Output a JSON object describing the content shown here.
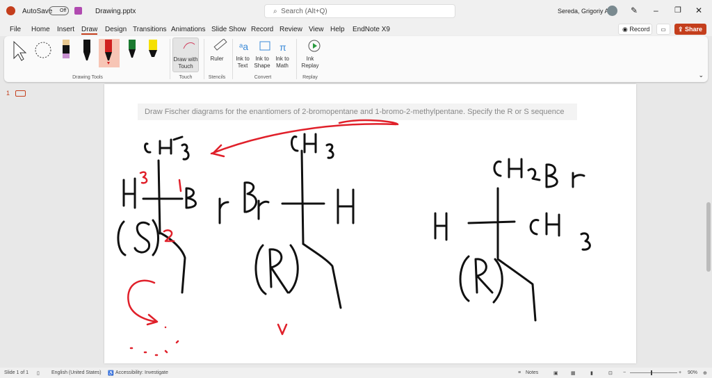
{
  "titlebar": {
    "autosave": "AutoSave",
    "autosave_state": "Off",
    "filename": "Drawing.pptx",
    "search_placeholder": "Search (Alt+Q)",
    "user": "Sereda, Grigoriy A"
  },
  "menu": [
    "File",
    "Home",
    "Insert",
    "Draw",
    "Design",
    "Transitions",
    "Animations",
    "Slide Show",
    "Record",
    "Review",
    "View",
    "Help",
    "EndNote X9"
  ],
  "actions": {
    "record": "Record",
    "share": "Share"
  },
  "ribbon": {
    "draw_with_touch": "Draw with Touch",
    "ruler": "Ruler",
    "ink_to_text": "Ink to Text",
    "ink_to_shape": "Ink to Shape",
    "ink_to_math": "Ink to Math",
    "ink_replay": "Ink Replay",
    "groups": [
      "Drawing Tools",
      "Touch",
      "Stencils",
      "Convert",
      "Replay"
    ]
  },
  "thumbnail": {
    "number": "1"
  },
  "slide": {
    "question": "Draw Fischer diagrams for the enantiomers of 2-bromopentane and 1-bromo-2-methylpentane. Specify the R or S sequence"
  },
  "status": {
    "slide": "Slide 1 of 1",
    "language": "English (United States)",
    "accessibility": "Accessibility: Investigate",
    "notes": "Notes",
    "zoom": "90%"
  },
  "colors": {
    "accent": "#c43e1c",
    "ink_red": "#e0202a",
    "ink_black": "#111111"
  }
}
